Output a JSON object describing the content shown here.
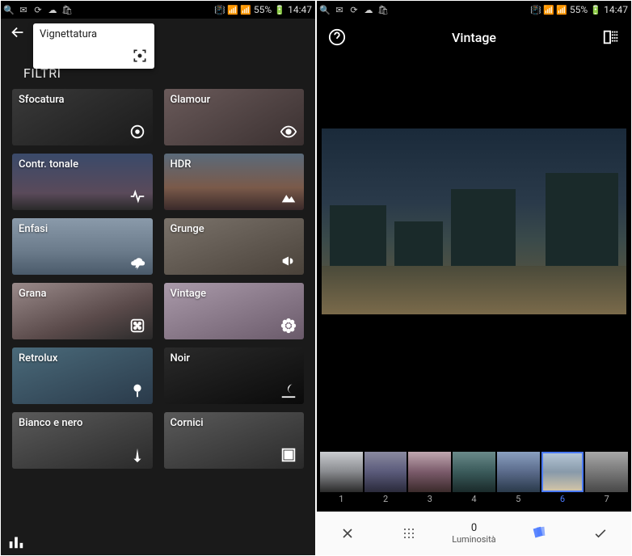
{
  "statusbar": {
    "battery": "55%",
    "time": "14:47"
  },
  "left": {
    "popup_label": "Vignettatura",
    "section_title": "FILTRI",
    "filters": [
      {
        "label": "Sfocatura",
        "icon": "target-icon",
        "cls": "f-sfocatura"
      },
      {
        "label": "Glamour",
        "icon": "eye-icon",
        "cls": "f-glamour"
      },
      {
        "label": "Contr. tonale",
        "icon": "pulse-icon",
        "cls": "f-contr"
      },
      {
        "label": "HDR",
        "icon": "mountains-icon",
        "cls": "f-hdr"
      },
      {
        "label": "Enfasi",
        "icon": "cloud-bolt-icon",
        "cls": "f-enfasi"
      },
      {
        "label": "Grunge",
        "icon": "megaphone-icon",
        "cls": "f-grunge"
      },
      {
        "label": "Grana",
        "icon": "dice-icon",
        "cls": "f-grana"
      },
      {
        "label": "Vintage",
        "icon": "flower-icon",
        "cls": "f-vintage"
      },
      {
        "label": "Retrolux",
        "icon": "balloon-icon",
        "cls": "f-retrolux"
      },
      {
        "label": "Noir",
        "icon": "night-icon",
        "cls": "f-noir"
      },
      {
        "label": "Bianco e nero",
        "icon": "eiffel-icon",
        "cls": "f-bw"
      },
      {
        "label": "Cornici",
        "icon": "frame-icon",
        "cls": "f-cornici"
      }
    ]
  },
  "right": {
    "title": "Vintage",
    "thumbs": [
      {
        "n": "1",
        "grad": "linear-gradient(180deg,#caccd0,#888a8e,#2a2a2a)",
        "selected": false
      },
      {
        "n": "2",
        "grad": "linear-gradient(180deg,#8a8aa0,#5a5a7a,#2a2a3a)",
        "selected": false
      },
      {
        "n": "3",
        "grad": "linear-gradient(180deg,#c0a8b0,#7a5a6a,#3a2a2a)",
        "selected": false
      },
      {
        "n": "4",
        "grad": "linear-gradient(180deg,#6a8a8a,#3a5a5a,#1a2a2a)",
        "selected": false
      },
      {
        "n": "5",
        "grad": "linear-gradient(180deg,#8aa0c0,#5a6a8a,#2a3a4a)",
        "selected": false
      },
      {
        "n": "6",
        "grad": "linear-gradient(180deg,#b8c8d8,#889aaa,#d8c8a8)",
        "selected": true
      },
      {
        "n": "7",
        "grad": "linear-gradient(180deg,#a8a8a8,#787878,#484848)",
        "selected": false
      }
    ],
    "bottombar": {
      "value": "0",
      "label": "Luminosità"
    }
  }
}
